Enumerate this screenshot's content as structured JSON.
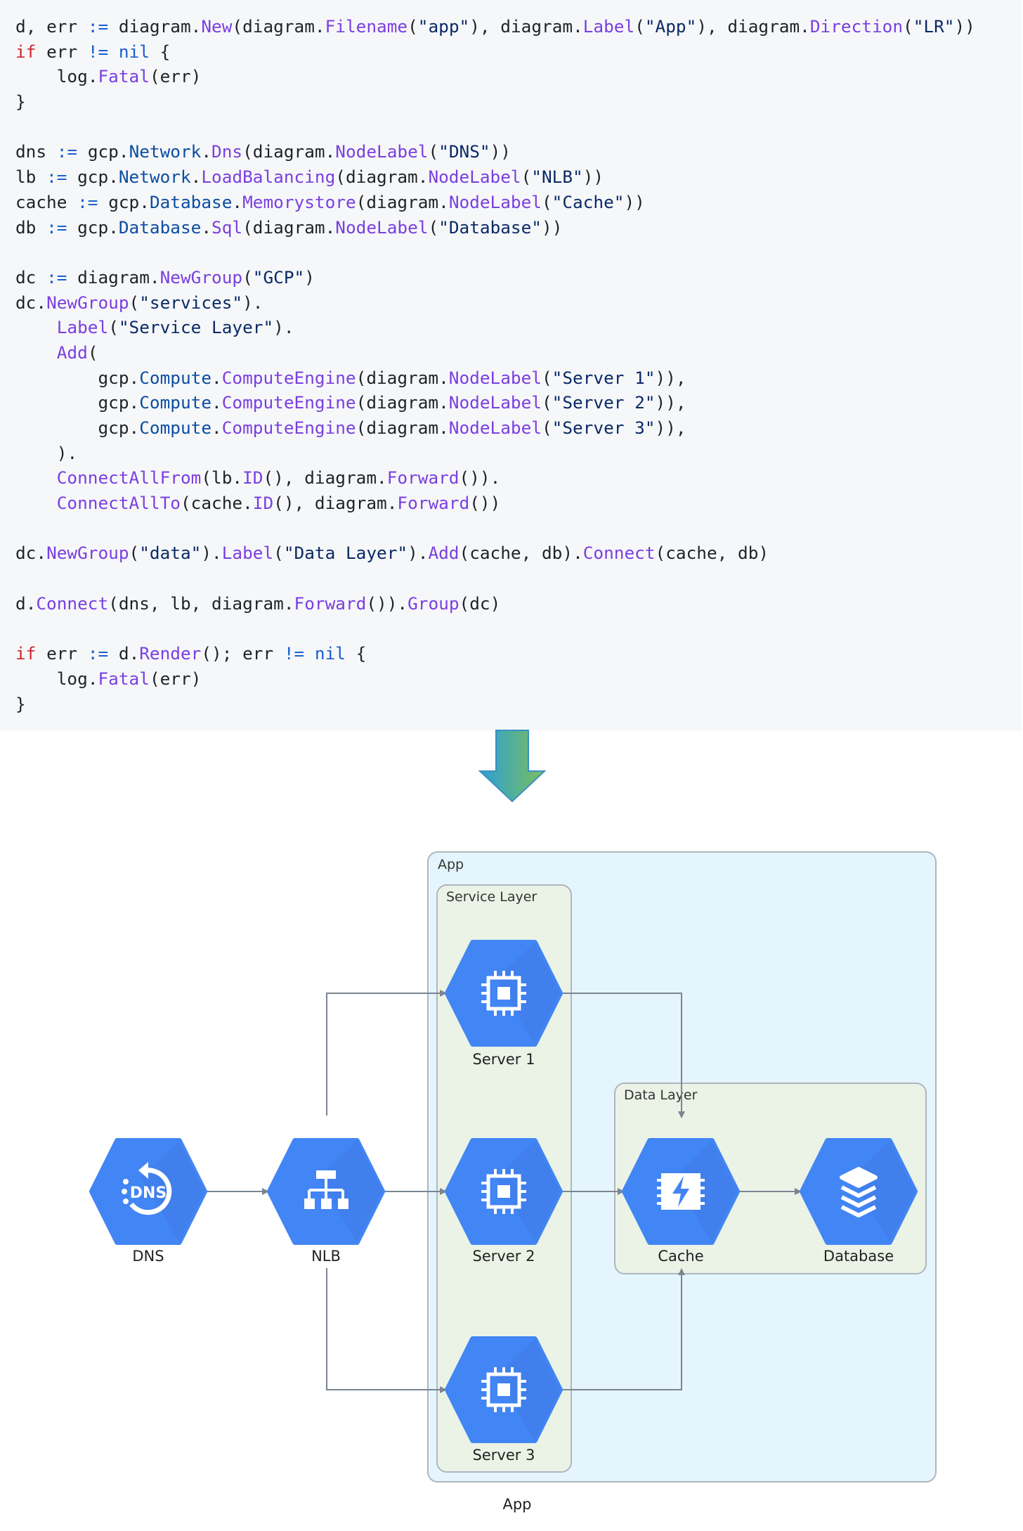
{
  "code": {
    "lines": [
      "d, err := diagram.New(diagram.Filename(\"app\"), diagram.Label(\"App\"), diagram.Direction(\"LR\"))",
      "if err != nil {",
      "    log.Fatal(err)",
      "}",
      "",
      "dns := gcp.Network.Dns(diagram.NodeLabel(\"DNS\"))",
      "lb := gcp.Network.LoadBalancing(diagram.NodeLabel(\"NLB\"))",
      "cache := gcp.Database.Memorystore(diagram.NodeLabel(\"Cache\"))",
      "db := gcp.Database.Sql(diagram.NodeLabel(\"Database\"))",
      "",
      "dc := diagram.NewGroup(\"GCP\")",
      "dc.NewGroup(\"services\").",
      "    Label(\"Service Layer\").",
      "    Add(",
      "        gcp.Compute.ComputeEngine(diagram.NodeLabel(\"Server 1\")),",
      "        gcp.Compute.ComputeEngine(diagram.NodeLabel(\"Server 2\")),",
      "        gcp.Compute.ComputeEngine(diagram.NodeLabel(\"Server 3\")),",
      "    ).",
      "    ConnectAllFrom(lb.ID(), diagram.Forward()).",
      "    ConnectAllTo(cache.ID(), diagram.Forward())",
      "",
      "dc.NewGroup(\"data\").Label(\"Data Layer\").Add(cache, db).Connect(cache, db)",
      "",
      "d.Connect(dns, lb, diagram.Forward()).Group(dc)",
      "",
      "if err := d.Render(); err != nil {",
      "    log.Fatal(err)",
      "}"
    ]
  },
  "diagram": {
    "caption": "App",
    "clusters": {
      "app": "App",
      "service": "Service Layer",
      "data": "Data Layer"
    },
    "nodes": {
      "dns": "DNS",
      "nlb": "NLB",
      "server1": "Server 1",
      "server2": "Server 2",
      "server3": "Server 3",
      "cache": "Cache",
      "database": "Database"
    },
    "colors": {
      "node": "#4285f4",
      "node_shadow": "#3b76dc",
      "app_cluster": "#e5f5fd",
      "layer_cluster": "#ebf3e7",
      "arrow": "#7b8591"
    }
  }
}
